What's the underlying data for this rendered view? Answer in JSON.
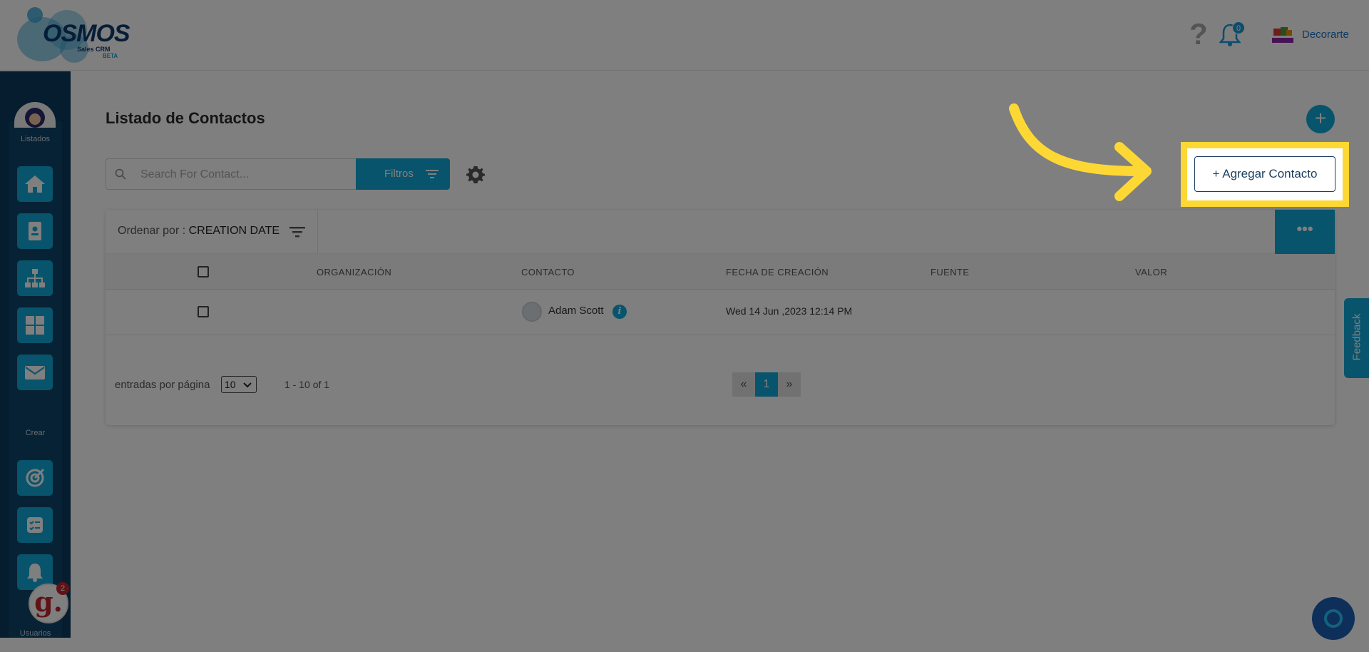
{
  "header": {
    "logo_text": "OSMOS",
    "logo_sub": "Sales CRM",
    "logo_beta": "BETA",
    "help_icon": "question-mark-icon",
    "notifications_icon": "bell-icon",
    "notifications_count": "0",
    "company_name": "Decorarte"
  },
  "sidebar": {
    "section_listados": "Listados",
    "section_crear": "Crear",
    "section_usuarios": "Usuarios",
    "listados_items": [
      {
        "name": "home",
        "icon": "home-icon"
      },
      {
        "name": "contacts",
        "icon": "contact-card-icon"
      },
      {
        "name": "organizations",
        "icon": "org-chart-icon"
      },
      {
        "name": "dashboard",
        "icon": "grid-icon"
      },
      {
        "name": "mail",
        "icon": "mail-icon"
      }
    ],
    "crear_items": [
      {
        "name": "target",
        "icon": "target-icon"
      },
      {
        "name": "tasks",
        "icon": "checklist-icon"
      },
      {
        "name": "reminders",
        "icon": "bell-icon"
      }
    ]
  },
  "main": {
    "title": "Listado de Contactos",
    "search_placeholder": "Search For Contact...",
    "filter_label": "Filtros",
    "add_contact_label": "+ Agregar Contacto",
    "sort_prefix": "Ordenar por : ",
    "sort_value": "CREATION DATE",
    "more_label": "•••",
    "columns": [
      "ORGANIZACIÓN",
      "CONTACTO",
      "FECHA DE CREACIÓN",
      "FUENTE",
      "VALOR"
    ],
    "rows": [
      {
        "organization": "",
        "contact": "Adam Scott",
        "created": "Wed 14 Jun ,2023 12:14 PM",
        "source": "",
        "value": ""
      }
    ],
    "per_page_label": "entradas por página",
    "per_page_value": "10",
    "range_text": "1 - 10 of 1",
    "pager": {
      "prev": "«",
      "current": "1",
      "next": "»"
    }
  },
  "widgets": {
    "feedback_label": "Feedback",
    "g_letter": "g.",
    "g_count": "2"
  },
  "colors": {
    "accent": "#11a8d8",
    "sidebar": "#0b3b5c",
    "highlight": "#fdd835",
    "overlay": "rgba(0,0,0,0.5)"
  }
}
